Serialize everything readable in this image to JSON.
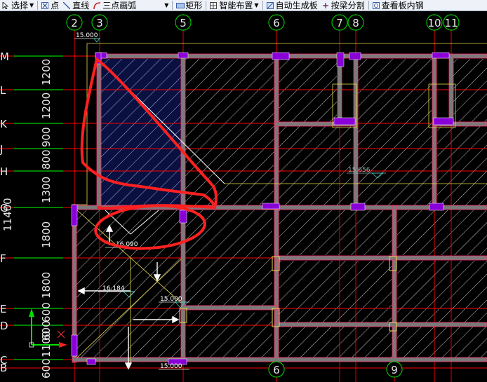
{
  "toolbar": {
    "items": [
      {
        "label": "选择",
        "icon": "select-arrow-icon",
        "dropdown": true
      },
      {
        "label": "点",
        "icon": "point-icon",
        "dropdown": false
      },
      {
        "label": "直线",
        "icon": "line-icon",
        "dropdown": false
      },
      {
        "label": "三点画弧",
        "icon": "arc-icon",
        "dropdown": true
      },
      {
        "label": "矩形",
        "icon": "rectangle-icon",
        "dropdown": false
      },
      {
        "label": "智能布置",
        "icon": "smart-layout-icon",
        "dropdown": true
      },
      {
        "label": "自动生成板",
        "icon": "auto-slab-icon",
        "dropdown": false
      },
      {
        "label": "按梁分割",
        "icon": "split-by-beam-icon",
        "dropdown": false
      },
      {
        "label": "查看板内钢",
        "icon": "view-rebar-icon",
        "dropdown": false
      }
    ]
  },
  "grid": {
    "top_axes": [
      "2",
      "3",
      "5",
      "6",
      "7",
      "8",
      "10",
      "11"
    ],
    "bottom_axes": [
      "6",
      "9"
    ],
    "left_axes": [
      "M",
      "L",
      "K",
      "J",
      "H",
      "G",
      "F",
      "E",
      "D",
      "C",
      "B"
    ],
    "left_dims": [
      "1200",
      "1200",
      "900",
      "800",
      "1300",
      "1800",
      "1800",
      "600",
      "600",
      "1100",
      "600"
    ],
    "left_total_dim": "11400"
  },
  "elevations": {
    "top_left": "15.000",
    "room_a": "16.090",
    "room_b": "16.184",
    "room_c": "15.000",
    "bottom": "15.000",
    "right_room": "15.656"
  },
  "colors": {
    "background": "#000000",
    "axis_line": "#ff0000",
    "left_axis_line": "#00ff00",
    "wall_fill": "#7a7a7a",
    "wall_edge": "#ff2a6a",
    "column": "#8a00d8",
    "slab_hatch": "#dcdcdc",
    "highlight_slab": "#0a1040",
    "annotation": "#ff2020",
    "bubble": "#00c000"
  }
}
